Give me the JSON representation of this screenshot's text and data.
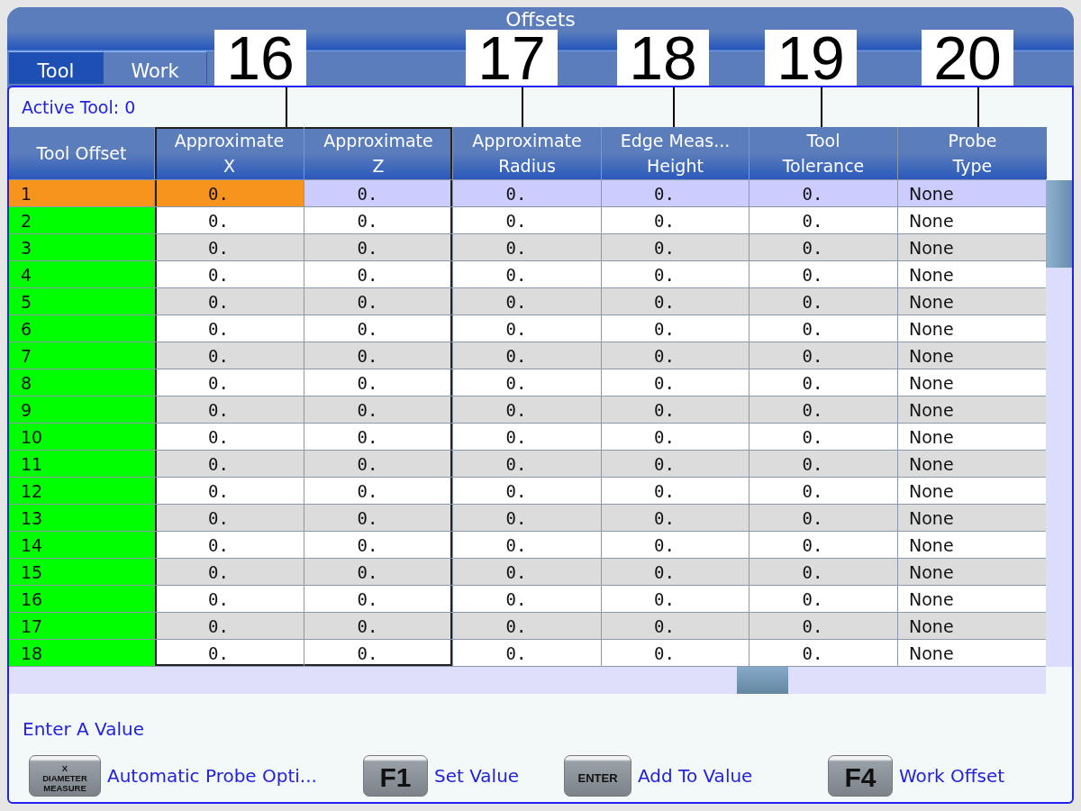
{
  "window": {
    "title": "Offsets"
  },
  "tabs": [
    {
      "label": "Tool",
      "selected": true
    },
    {
      "label": "Work",
      "selected": false
    }
  ],
  "active_tool": "Active Tool: 0",
  "table": {
    "columns": [
      {
        "label": "Tool Offset",
        "kind": "tool",
        "selected": false,
        "framed": false
      },
      {
        "label": "Approximate\nX",
        "kind": "number",
        "selected": true,
        "framed": true
      },
      {
        "label": "Approximate\nZ",
        "kind": "number",
        "selected": false,
        "framed": true
      },
      {
        "label": "Approximate\nRadius",
        "kind": "number",
        "selected": false,
        "framed": false
      },
      {
        "label": "Edge Meas...\nHeight",
        "kind": "number",
        "selected": false,
        "framed": false
      },
      {
        "label": "Tool\nTolerance",
        "kind": "number",
        "selected": false,
        "framed": false
      },
      {
        "label": "Probe\nType",
        "kind": "text",
        "selected": false,
        "framed": false
      }
    ],
    "rows": [
      {
        "cells": [
          "1",
          "0.",
          "0.",
          "0.",
          "0.",
          "0.",
          "None"
        ],
        "selected": true
      },
      {
        "cells": [
          "2",
          "0.",
          "0.",
          "0.",
          "0.",
          "0.",
          "None"
        ],
        "selected": false
      },
      {
        "cells": [
          "3",
          "0.",
          "0.",
          "0.",
          "0.",
          "0.",
          "None"
        ],
        "selected": false
      },
      {
        "cells": [
          "4",
          "0.",
          "0.",
          "0.",
          "0.",
          "0.",
          "None"
        ],
        "selected": false
      },
      {
        "cells": [
          "5",
          "0.",
          "0.",
          "0.",
          "0.",
          "0.",
          "None"
        ],
        "selected": false
      },
      {
        "cells": [
          "6",
          "0.",
          "0.",
          "0.",
          "0.",
          "0.",
          "None"
        ],
        "selected": false
      },
      {
        "cells": [
          "7",
          "0.",
          "0.",
          "0.",
          "0.",
          "0.",
          "None"
        ],
        "selected": false
      },
      {
        "cells": [
          "8",
          "0.",
          "0.",
          "0.",
          "0.",
          "0.",
          "None"
        ],
        "selected": false
      },
      {
        "cells": [
          "9",
          "0.",
          "0.",
          "0.",
          "0.",
          "0.",
          "None"
        ],
        "selected": false
      },
      {
        "cells": [
          "10",
          "0.",
          "0.",
          "0.",
          "0.",
          "0.",
          "None"
        ],
        "selected": false
      },
      {
        "cells": [
          "11",
          "0.",
          "0.",
          "0.",
          "0.",
          "0.",
          "None"
        ],
        "selected": false
      },
      {
        "cells": [
          "12",
          "0.",
          "0.",
          "0.",
          "0.",
          "0.",
          "None"
        ],
        "selected": false
      },
      {
        "cells": [
          "13",
          "0.",
          "0.",
          "0.",
          "0.",
          "0.",
          "None"
        ],
        "selected": false
      },
      {
        "cells": [
          "14",
          "0.",
          "0.",
          "0.",
          "0.",
          "0.",
          "None"
        ],
        "selected": false
      },
      {
        "cells": [
          "15",
          "0.",
          "0.",
          "0.",
          "0.",
          "0.",
          "None"
        ],
        "selected": false
      },
      {
        "cells": [
          "16",
          "0.",
          "0.",
          "0.",
          "0.",
          "0.",
          "None"
        ],
        "selected": false
      },
      {
        "cells": [
          "17",
          "0.",
          "0.",
          "0.",
          "0.",
          "0.",
          "None"
        ],
        "selected": false
      },
      {
        "cells": [
          "18",
          "0.",
          "0.",
          "0.",
          "0.",
          "0.",
          "None"
        ],
        "selected": false
      }
    ]
  },
  "prompt": "Enter A Value",
  "keys": [
    {
      "key": "X\nDIAMETER\nMEASURE",
      "kind": "small",
      "label": "Automatic Probe Opti..."
    },
    {
      "key": "F1",
      "kind": "large",
      "label": "Set Value"
    },
    {
      "key": "ENTER",
      "kind": "medium",
      "label": "Add To Value"
    },
    {
      "key": "F4",
      "kind": "large",
      "label": "Work Offset"
    }
  ],
  "callouts": [
    "16",
    "17",
    "18",
    "19",
    "20"
  ]
}
